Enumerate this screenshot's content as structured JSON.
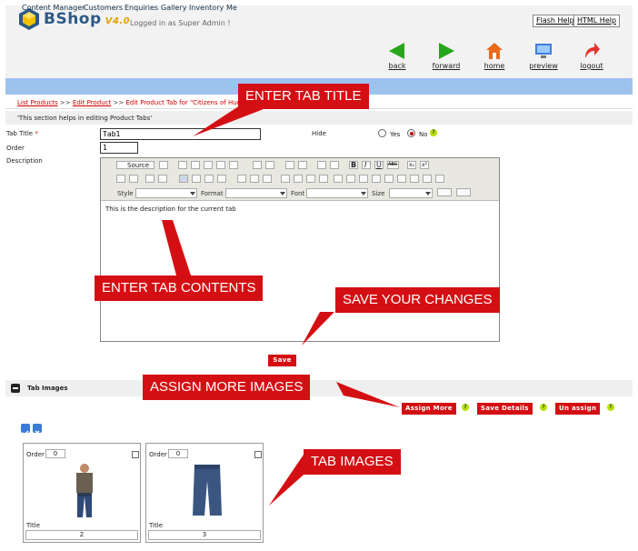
{
  "app": {
    "name": "BShop",
    "version": "V4.0",
    "logged_in": "Logged in as Super Admin !"
  },
  "header": {
    "help_links": [
      "Flash Help",
      "HTML Help"
    ],
    "toolbar": [
      "back",
      "forward",
      "home",
      "preview",
      "logout"
    ]
  },
  "nav": {
    "items": [
      "Content Manager",
      "Customers",
      "Enquiries",
      "Gallery",
      "Inventory",
      "Me"
    ]
  },
  "breadcrumb": {
    "items": [
      "List Products",
      "Edit Product",
      "Edit Product Tab for \"Citizens of Hum"
    ],
    "separator": ">>"
  },
  "info": "'This section helps in editing Product Tabs'",
  "form": {
    "tab_title_label": "Tab Title",
    "required_mark": "*",
    "tab_title_value": "Tab1",
    "order_label": "Order",
    "order_value": "1",
    "description_label": "Description",
    "hide_label": "Hide",
    "hide_yes": "Yes",
    "hide_no": "No",
    "hide_selected": "No"
  },
  "editor": {
    "source_label": "Source",
    "style_label": "Style",
    "format_label": "Format",
    "font_label": "Font",
    "size_label": "Size",
    "bold": "B",
    "italic": "I",
    "underline": "U",
    "strike": "ABC",
    "subscript": "x₂",
    "superscript": "x²",
    "content": "This is the description for the current tab"
  },
  "save_label": "Save",
  "tab_images": {
    "section_title": "Tab Images",
    "buttons": [
      "Assign More",
      "Save Details",
      "Un assign"
    ],
    "items": [
      {
        "order_label": "Order",
        "order": "0",
        "title_label": "Title",
        "title": "2"
      },
      {
        "order_label": "Order",
        "order": "0",
        "title_label": "Title",
        "title": "3"
      }
    ]
  },
  "callouts": {
    "enter_title": "ENTER TAB  TITLE",
    "enter_contents": "ENTER TAB CONTENTS",
    "save_changes": "SAVE YOUR CHANGES",
    "assign_more": "ASSIGN MORE IMAGES",
    "tab_images": "TAB IMAGES"
  },
  "colors": {
    "accent": "#d40f13",
    "nav": "#9ec2ee",
    "brand": "#2c5a86",
    "link": "#cc0000",
    "help_badge": "#b8e000"
  }
}
